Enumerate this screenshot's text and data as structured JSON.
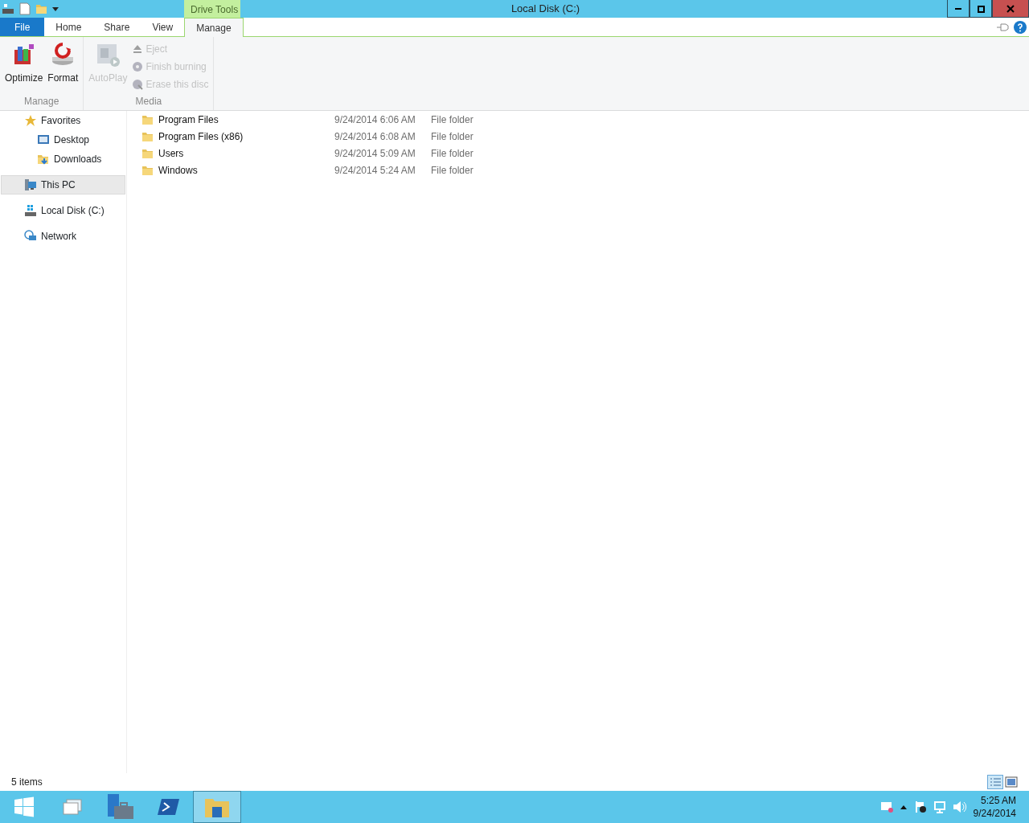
{
  "window": {
    "title": "Local Disk (C:)",
    "context_tab_group": "Drive Tools"
  },
  "ribbon_tabs": [
    {
      "label": "File",
      "kind": "file",
      "selected": false
    },
    {
      "label": "Home",
      "kind": "tab",
      "selected": false
    },
    {
      "label": "Share",
      "kind": "tab",
      "selected": false
    },
    {
      "label": "View",
      "kind": "tab",
      "selected": false
    },
    {
      "label": "Manage",
      "kind": "tab",
      "selected": true
    }
  ],
  "ribbon_groups": [
    {
      "label": "Manage",
      "commands": [
        {
          "label": "Optimize",
          "kind": "large",
          "disabled": false
        },
        {
          "label": "Format",
          "kind": "large",
          "disabled": false
        }
      ]
    },
    {
      "label": "Media",
      "commands": [
        {
          "label": "AutoPlay",
          "kind": "large",
          "disabled": true
        },
        {
          "label": "Eject",
          "kind": "small",
          "disabled": true
        },
        {
          "label": "Finish burning",
          "kind": "small",
          "disabled": true
        },
        {
          "label": "Erase this disc",
          "kind": "small",
          "disabled": true
        }
      ]
    }
  ],
  "navigation": [
    {
      "label": "Favorites",
      "selected": false,
      "children": [
        {
          "label": "Desktop",
          "selected": false
        },
        {
          "label": "Downloads",
          "selected": false
        }
      ]
    },
    {
      "label": "This PC",
      "selected": true
    },
    {
      "label": "Local Disk (C:)",
      "selected": false
    },
    {
      "label": "Network",
      "selected": false
    }
  ],
  "files": [
    {
      "name": "Program Files",
      "date": "9/24/2014 6:06 AM",
      "type": "File folder"
    },
    {
      "name": "Program Files (x86)",
      "date": "9/24/2014 6:08 AM",
      "type": "File folder"
    },
    {
      "name": "Users",
      "date": "9/24/2014 5:09 AM",
      "type": "File folder"
    },
    {
      "name": "Windows",
      "date": "9/24/2014 5:24 AM",
      "type": "File folder"
    }
  ],
  "status_bar": {
    "item_count": "5 items"
  },
  "taskbar": {
    "apps": [
      {
        "selected": false
      },
      {
        "selected": false
      },
      {
        "selected": false
      },
      {
        "selected": false
      },
      {
        "selected": true
      }
    ],
    "time": "5:25 AM",
    "date": "9/24/2014"
  }
}
